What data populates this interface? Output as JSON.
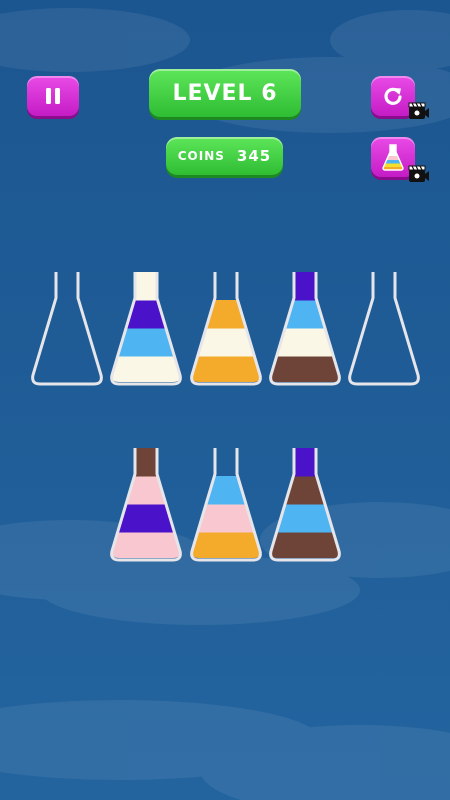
{
  "header": {
    "level_label": "LEVEL 6",
    "coins_label": "COINS",
    "coins_value": "345"
  },
  "icons": {
    "pause": "pause-icon",
    "restart": "restart-icon",
    "hint": "potion-hint-icon",
    "ad_video": "camera-icon"
  },
  "colors": {
    "background": "#1e5a96",
    "button_pink": "#d62fd6",
    "button_green": "#3fcf40",
    "liquids": {
      "white": "#faf7e6",
      "indigo": "#4a12c9",
      "sky": "#4fb4f2",
      "orange": "#f4aa2a",
      "brown": "#6e4438",
      "pink": "#f9c7cf"
    }
  },
  "tubes": [
    {
      "id": "tube-1",
      "layers": []
    },
    {
      "id": "tube-2",
      "layers": [
        "white",
        "sky",
        "indigo",
        "white"
      ]
    },
    {
      "id": "tube-3",
      "layers": [
        "orange",
        "white",
        "orange"
      ]
    },
    {
      "id": "tube-4",
      "layers": [
        "brown",
        "white",
        "sky",
        "indigo"
      ]
    },
    {
      "id": "tube-5",
      "layers": []
    },
    {
      "id": "tube-6",
      "layers": [
        "pink",
        "indigo",
        "pink",
        "brown"
      ]
    },
    {
      "id": "tube-7",
      "layers": [
        "orange",
        "pink",
        "sky"
      ]
    },
    {
      "id": "tube-8",
      "layers": [
        "brown",
        "sky",
        "brown",
        "indigo"
      ]
    }
  ]
}
